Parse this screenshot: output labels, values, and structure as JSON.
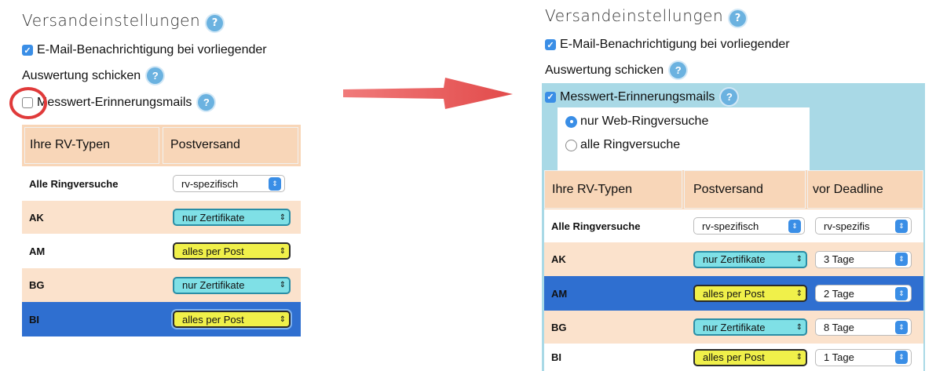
{
  "left": {
    "title": "Versandeinstellungen",
    "help": "?",
    "email_label_1": "E-Mail-Benachrichtigung bei vorliegender",
    "email_label_2": "Auswertung schicken",
    "messwert_label": "Messwert-Erinnerungsmails",
    "messwert_checked": false,
    "headers": [
      "Ihre RV-Typen",
      "Postversand"
    ],
    "rows": [
      {
        "name": "Alle Ringversuche",
        "post": "rv-spezifisch"
      },
      {
        "name": "AK",
        "post": "nur Zertifikate"
      },
      {
        "name": "AM",
        "post": "alles per Post"
      },
      {
        "name": "BG",
        "post": "nur Zertifikate"
      },
      {
        "name": "BI",
        "post": "alles per Post"
      }
    ]
  },
  "right": {
    "title": "Versandeinstellungen",
    "help": "?",
    "email_label_1": "E-Mail-Benachrichtigung bei vorliegender",
    "email_label_2": "Auswertung schicken",
    "messwert_label": "Messwert-Erinnerungsmails",
    "messwert_checked": true,
    "radio_web": "nur Web-Ringversuche",
    "radio_all": "alle Ringversuche",
    "headers": [
      "Ihre RV-Typen",
      "Postversand",
      "vor Deadline"
    ],
    "rows": [
      {
        "name": "Alle Ringversuche",
        "post": "rv-spezifisch",
        "deadline": "rv-spezifis"
      },
      {
        "name": "AK",
        "post": "nur Zertifikate",
        "deadline": "3 Tage"
      },
      {
        "name": "AM",
        "post": "alles per Post",
        "deadline": "2 Tage"
      },
      {
        "name": "BG",
        "post": "nur Zertifikate",
        "deadline": "8 Tage"
      },
      {
        "name": "BI",
        "post": "alles per Post",
        "deadline": "1 Tage"
      }
    ]
  },
  "icons": {
    "checkmark": "✓",
    "updown": "⇕",
    "arrow": "right-arrow"
  },
  "colors": {
    "header_bg": "#f8d6b8",
    "row_alt": "#fbe2cc",
    "selected_row": "#2f6fd0",
    "panel_blue": "#a9d9e6",
    "arrow_red": "#e65a5a",
    "highlight_circle": "#e03a3a"
  }
}
